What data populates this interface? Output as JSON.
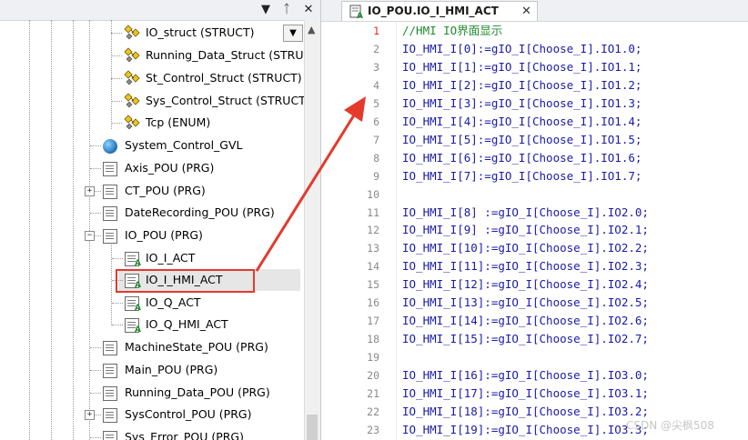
{
  "tree_header": {
    "pin": "▾",
    "pin2": "ᵖ",
    "close": "✕"
  },
  "tree": {
    "rows": [
      {
        "label": "IO_struct (STRUCT)",
        "icon": "struct-icon"
      },
      {
        "label": "Running_Data_Struct (STRUCT)",
        "icon": "struct-icon"
      },
      {
        "label": "St_Control_Struct (STRUCT)",
        "icon": "struct-icon"
      },
      {
        "label": "Sys_Control_Struct (STRUCT)",
        "icon": "struct-icon"
      },
      {
        "label": "Tcp (ENUM)",
        "icon": "struct-icon"
      },
      {
        "label": "System_Control_GVL",
        "icon": "globe-icon"
      },
      {
        "label": "Axis_POU (PRG)",
        "icon": "page-icon"
      },
      {
        "label": "CT_POU (PRG)",
        "icon": "page-icon"
      },
      {
        "label": "DateRecording_POU (PRG)",
        "icon": "page-icon"
      },
      {
        "label": "IO_POU (PRG)",
        "icon": "page-icon"
      },
      {
        "label": "IO_I_ACT",
        "icon": "action-icon"
      },
      {
        "label": "IO_I_HMI_ACT",
        "icon": "action-icon"
      },
      {
        "label": "IO_Q_ACT",
        "icon": "action-icon"
      },
      {
        "label": "IO_Q_HMI_ACT",
        "icon": "action-icon"
      },
      {
        "label": "MachineState_POU (PRG)",
        "icon": "page-icon"
      },
      {
        "label": "Main_POU (PRG)",
        "icon": "page-icon"
      },
      {
        "label": "Running_Data_POU (PRG)",
        "icon": "page-icon"
      },
      {
        "label": "SysControl_POU (PRG)",
        "icon": "page-icon"
      },
      {
        "label": "Sys_Error_POU (PRG)",
        "icon": "page-icon"
      }
    ],
    "plus": "+",
    "minus": "−",
    "badge": "A"
  },
  "editor": {
    "tab_label": "IO_POU.IO_I_HMI_ACT",
    "tab_close": "✕",
    "line_numbers": [
      "1",
      "2",
      "3",
      "4",
      "5",
      "6",
      "7",
      "8",
      "9",
      "10",
      "11",
      "12",
      "13",
      "14",
      "15",
      "16",
      "17",
      "18",
      "19",
      "20",
      "21",
      "22",
      "23"
    ],
    "lines": [
      "//HMI IO界面显示",
      "IO_HMI_I[0]:=gIO_I[Choose_I].IO1.0;",
      "IO_HMI_I[1]:=gIO_I[Choose_I].IO1.1;",
      "IO_HMI_I[2]:=gIO_I[Choose_I].IO1.2;",
      "IO_HMI_I[3]:=gIO_I[Choose_I].IO1.3;",
      "IO_HMI_I[4]:=gIO_I[Choose_I].IO1.4;",
      "IO_HMI_I[5]:=gIO_I[Choose_I].IO1.5;",
      "IO_HMI_I[6]:=gIO_I[Choose_I].IO1.6;",
      "IO_HMI_I[7]:=gIO_I[Choose_I].IO1.7;",
      "",
      "IO_HMI_I[8] :=gIO_I[Choose_I].IO2.0;",
      "IO_HMI_I[9] :=gIO_I[Choose_I].IO2.1;",
      "IO_HMI_I[10]:=gIO_I[Choose_I].IO2.2;",
      "IO_HMI_I[11]:=gIO_I[Choose_I].IO2.3;",
      "IO_HMI_I[12]:=gIO_I[Choose_I].IO2.4;",
      "IO_HMI_I[13]:=gIO_I[Choose_I].IO2.5;",
      "IO_HMI_I[14]:=gIO_I[Choose_I].IO2.6;",
      "IO_HMI_I[15]:=gIO_I[Choose_I].IO2.7;",
      "",
      "IO_HMI_I[16]:=gIO_I[Choose_I].IO3.0;",
      "IO_HMI_I[17]:=gIO_I[Choose_I].IO3.1;",
      "IO_HMI_I[18]:=gIO_I[Choose_I].IO3.2;",
      "IO_HMI_I[19]:=gIO_I[Choose_I].IO3.3;"
    ]
  },
  "watermark": "CSDN @尖枫508",
  "colors": {
    "highlight_box": "#e33a2c",
    "arrow": "#e33a2c",
    "comment": "#1e8a2c",
    "code": "#1a1aa8"
  }
}
